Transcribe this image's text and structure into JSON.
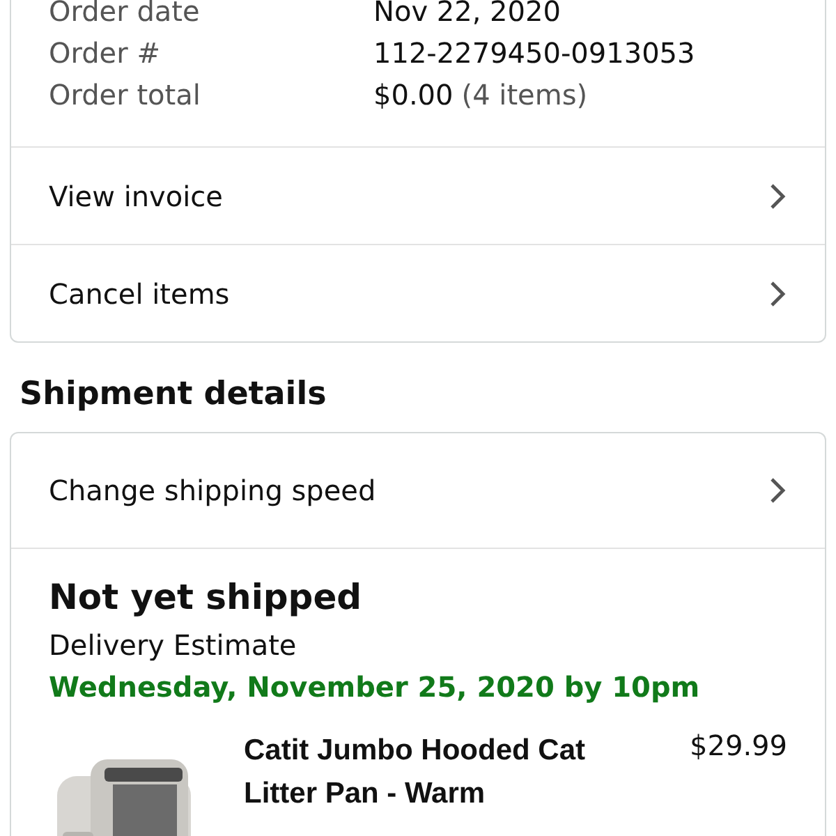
{
  "order_summary": {
    "fields": [
      {
        "label": "Order date",
        "value": "Nov 22, 2020"
      },
      {
        "label": "Order #",
        "value": "112-2279450-0913053"
      },
      {
        "label": "Order total",
        "value": "$0.00",
        "note": "(4 items)"
      }
    ],
    "links": [
      "View invoice",
      "Cancel items"
    ]
  },
  "shipment": {
    "heading": "Shipment details",
    "link": "Change shipping speed",
    "status": "Not yet shipped",
    "estimate_label": "Delivery Estimate",
    "estimate": "Wednesday, November 25, 2020 by 10pm",
    "items": [
      {
        "kind": "picture",
        "title": "Catit Jumbo Hooded Cat Litter Pan - Warm",
        "price": "$29.99"
      }
    ]
  }
}
